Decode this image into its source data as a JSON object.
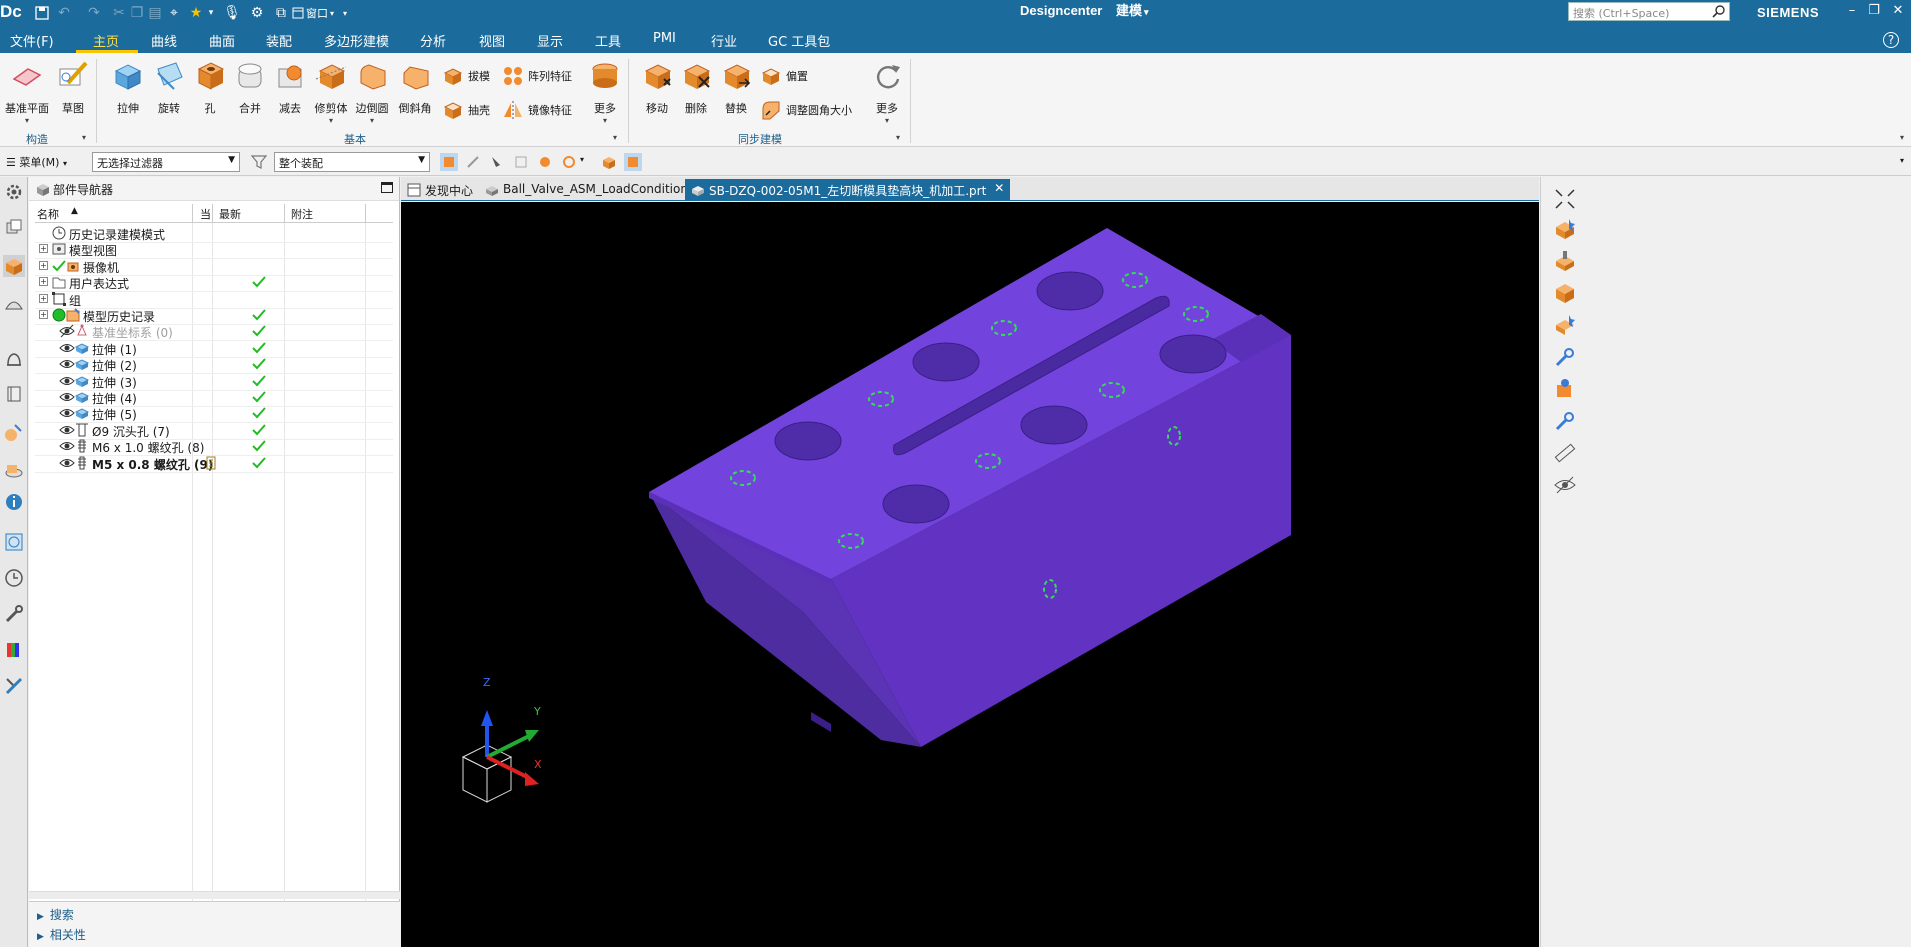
{
  "app": {
    "logo": "Dc",
    "title": "Designcenter",
    "mode": "建模",
    "search_placeholder": "搜索 (Ctrl+Space)",
    "brand": "SIEMENS",
    "window_menu": "窗口"
  },
  "menu": {
    "tabs": [
      "文件(F)",
      "主页",
      "曲线",
      "曲面",
      "装配",
      "多边形建模",
      "分析",
      "视图",
      "显示",
      "工具",
      "PMI",
      "行业",
      "GC 工具包"
    ],
    "active_index": 1
  },
  "ribbon": {
    "construct": {
      "datum_plane": "基准平面",
      "sketch": "草图",
      "group_label": "构造"
    },
    "basic": {
      "extrude": "拉伸",
      "revolve": "旋转",
      "hole": "孔",
      "unite": "合并",
      "subtract": "减去",
      "trim_body": "修剪体",
      "edge_blend": "边倒圆",
      "chamfer": "倒斜角",
      "draft": "拔模",
      "shell": "抽壳",
      "pattern_feature": "阵列特征",
      "mirror_feature": "镜像特征",
      "more": "更多",
      "group_label": "基本"
    },
    "sync": {
      "move": "移动",
      "delete": "删除",
      "replace": "替换",
      "offset": "偏置",
      "resize_blend": "调整圆角大小",
      "more": "更多",
      "group_label": "同步建模"
    }
  },
  "selection_bar": {
    "menu": "菜单(M)",
    "filter": "无选择过滤器",
    "scope": "整个装配"
  },
  "navigator": {
    "title": "部件导航器",
    "columns": {
      "name": "名称",
      "current": "当",
      "latest": "最新",
      "note": "附注"
    },
    "rows": [
      {
        "label": "历史记录建模模式",
        "checked": false
      },
      {
        "label": "模型视图",
        "checked": false
      },
      {
        "label": "摄像机",
        "checked": false
      },
      {
        "label": "用户表达式",
        "checked": true
      },
      {
        "label": "组",
        "checked": false
      },
      {
        "label": "模型历史记录",
        "checked": true
      },
      {
        "label": "基准坐标系 (0)",
        "checked": true
      },
      {
        "label": "拉伸 (1)",
        "checked": true
      },
      {
        "label": "拉伸 (2)",
        "checked": true
      },
      {
        "label": "拉伸 (3)",
        "checked": true
      },
      {
        "label": "拉伸 (4)",
        "checked": true
      },
      {
        "label": "拉伸 (5)",
        "checked": true
      },
      {
        "label": "Ø9 沉头孔 (7)",
        "checked": true
      },
      {
        "label": "M6 x 1.0 螺纹孔 (8)",
        "checked": true
      },
      {
        "label": "M5 x 0.8 螺纹孔 (9)",
        "checked": true
      }
    ],
    "bottom": {
      "search": "搜索",
      "dependencies": "相关性"
    }
  },
  "doc_tabs": [
    "发现中心",
    "Ball_Valve_ASM_LoadCondition.prt",
    "SB-DZQ-002-05M1_左切断模具垫高块_机加工.prt"
  ],
  "active_doc_tab": 2,
  "colors": {
    "accent": "#1b6b9c",
    "active_tab_text": "#ffe14d",
    "part_face": "#7040d8",
    "part_side": "#5a30b8",
    "check": "#22bb22"
  },
  "triad": {
    "x": "X",
    "y": "Y",
    "z": "Z"
  }
}
